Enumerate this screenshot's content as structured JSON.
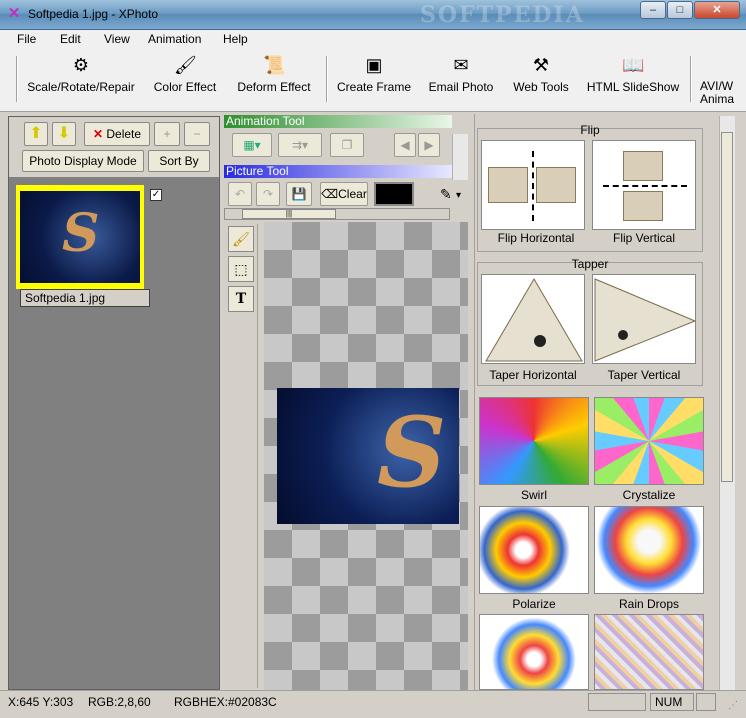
{
  "window": {
    "title": "Softpedia 1.jpg - XPhoto",
    "watermark": "SOFTPEDIA",
    "controls": {
      "minimize": "–",
      "maximize": "□",
      "close": "✕"
    }
  },
  "menu": [
    "File",
    "Edit",
    "View",
    "Animation",
    "Help"
  ],
  "toolbar": {
    "scale": "Scale/Rotate/Repair",
    "color": "Color Effect",
    "deform": "Deform Effect",
    "frame": "Create Frame",
    "email": "Email Photo",
    "web": "Web Tools",
    "html": "HTML SlideShow",
    "avi_line1": "AVI/W",
    "avi_line2": "Anima"
  },
  "left_panel": {
    "delete_label": "Delete",
    "display_mode": "Photo Display Mode",
    "sort_by": "Sort By",
    "thumbnail_label": "Softpedia 1.jpg",
    "thumbnail_checked": true
  },
  "middle_panel": {
    "animation_tool": "Animation Tool",
    "picture_tool": "Picture Tool",
    "clear_label": "Clear",
    "color_swatch": "#000000"
  },
  "right_panel": {
    "flip": {
      "title": "Flip",
      "items": [
        "Flip Horizontal",
        "Flip Vertical"
      ]
    },
    "tapper": {
      "title": "Tapper",
      "items": [
        "Taper Horizontal",
        "Taper Vertical"
      ]
    },
    "effects": [
      "Swirl",
      "Crystalize",
      "Polarize",
      "Rain Drops"
    ]
  },
  "status": {
    "coords": "X:645 Y:303",
    "rgb": "RGB:2,8,60",
    "rgbhex": "RGBHEX:#02083C",
    "num": "NUM"
  },
  "colors": {
    "selection_border": "#ffff00",
    "animation_strip": "#2f8f2f",
    "picture_strip": "#2a2ae0",
    "titlebar": "#6e9cc4"
  }
}
